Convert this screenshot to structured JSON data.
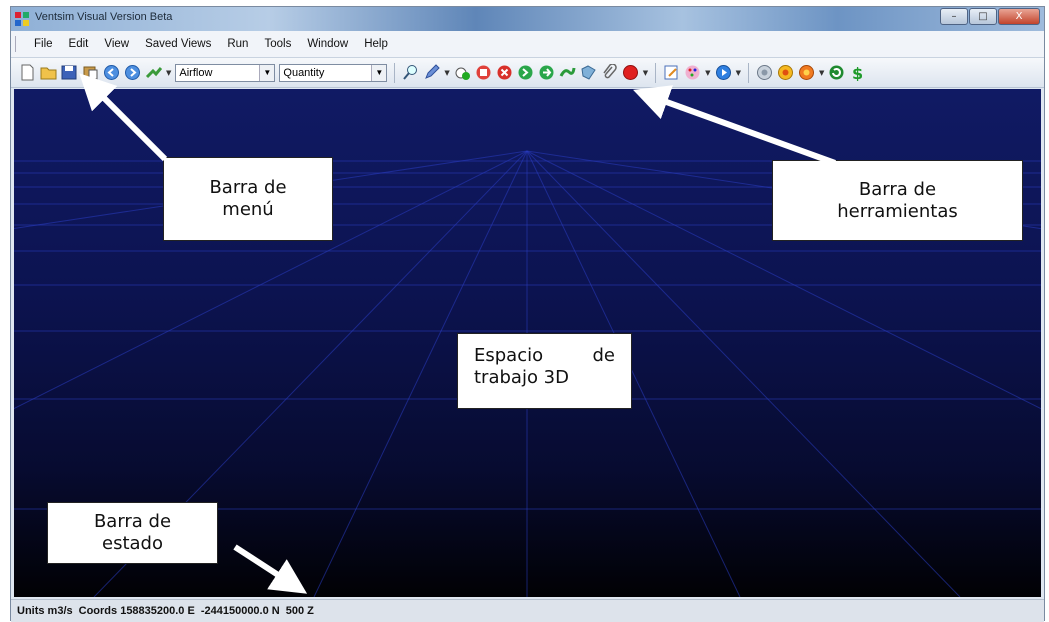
{
  "window": {
    "title": "Ventsim Visual Version Beta",
    "minimize": "–",
    "maximize": "□",
    "close": "X"
  },
  "menu": {
    "items": [
      "File",
      "Edit",
      "View",
      "Saved Views",
      "Run",
      "Tools",
      "Window",
      "Help"
    ]
  },
  "toolbar": {
    "display_combo": "Airflow",
    "value_combo": "Quantity",
    "icons": [
      "new-file-icon",
      "open-folder-icon",
      "save-icon",
      "paste-icon",
      "back-icon",
      "forward-icon",
      "airway-icon",
      "zoom-icon",
      "pencil-icon",
      "add-icon",
      "stop-icon",
      "delete-icon",
      "move-icon",
      "copy-icon",
      "link-icon",
      "fan-icon",
      "attach-icon",
      "record-icon",
      "edit-notes-icon",
      "palette-icon",
      "play-icon",
      "gas-icon",
      "heat-icon",
      "fire-icon",
      "refresh-icon",
      "dollar-icon"
    ]
  },
  "callouts": {
    "menu_bar": "Barra de menú",
    "menu_bar_line1": "Barra de",
    "menu_bar_line2": "menú",
    "toolbar_line1": "Barra de",
    "toolbar_line2": "herramientas",
    "workspace_line1": "Espacio de",
    "workspace_line2": "trabajo 3D",
    "status_line1": "Barra de",
    "status_line2": "estado"
  },
  "status": {
    "units": "Units m3/s",
    "coords_e": "Coords 158835200.0 E",
    "coords_n": "-244150000.0 N",
    "coords_z": "500 Z"
  },
  "colors": {
    "viewport_top": "#101a64",
    "viewport_bottom": "#010104",
    "grid_line": "#2a3cc0"
  }
}
